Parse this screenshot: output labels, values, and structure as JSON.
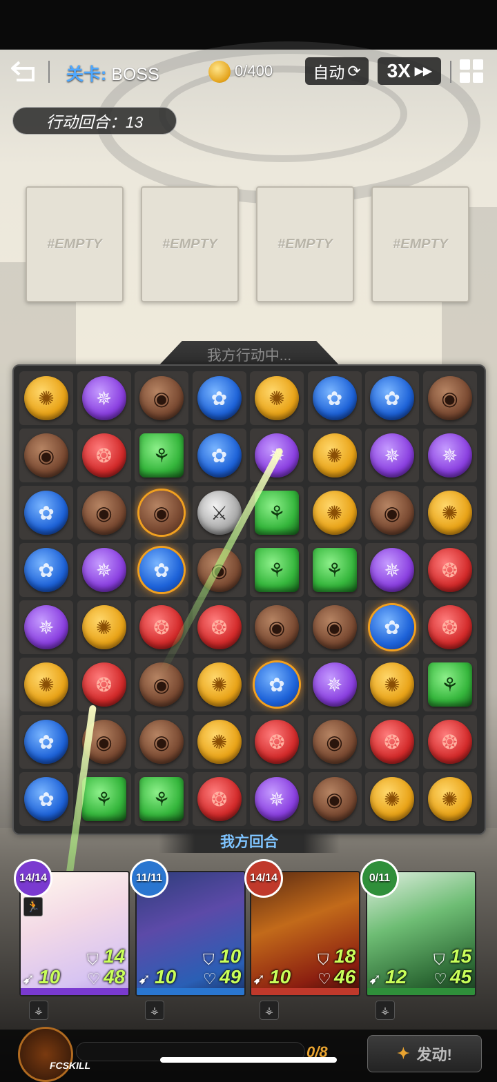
{
  "topbar": {
    "stage_key": "关卡:",
    "stage_value": "BOSS",
    "coins": "0/400",
    "auto_label": "自动",
    "speed_label": "3X"
  },
  "turns_label": "行动回合：13",
  "empty_slots": [
    "#EMPTY",
    "#EMPTY",
    "#EMPTY",
    "#EMPTY"
  ],
  "board": {
    "status": "我方行动中...",
    "turn_banner": "我方回合",
    "rows": [
      [
        "yellow",
        "purple",
        "brown",
        "blue",
        "yellow",
        "blue",
        "blue",
        "brown"
      ],
      [
        "brown",
        "red",
        "green",
        "blue",
        "purple",
        "yellow",
        "purple",
        "purple"
      ],
      [
        "blue",
        "brown",
        "brown",
        "sword",
        "green",
        "yellow",
        "brown",
        "yellow"
      ],
      [
        "blue",
        "purple",
        "blue",
        "brown",
        "green",
        "green",
        "purple",
        "red"
      ],
      [
        "purple",
        "yellow",
        "red",
        "red",
        "brown",
        "brown",
        "blue",
        "red"
      ],
      [
        "yellow",
        "red",
        "brown",
        "yellow",
        "blue",
        "purple",
        "yellow",
        "green"
      ],
      [
        "blue",
        "brown",
        "brown",
        "yellow",
        "red",
        "brown",
        "red",
        "red"
      ],
      [
        "blue",
        "green",
        "green",
        "red",
        "purple",
        "brown",
        "yellow",
        "yellow"
      ]
    ]
  },
  "heroes": [
    {
      "hp": "14/14",
      "def": "14",
      "atk": "10",
      "health": "48",
      "color": "#7a3ad0"
    },
    {
      "hp": "11/11",
      "def": "10",
      "atk": "10",
      "health": "49",
      "color": "#2a76d0"
    },
    {
      "hp": "14/14",
      "def": "18",
      "atk": "10",
      "health": "46",
      "color": "#c0392b"
    },
    {
      "hp": "0/11",
      "def": "15",
      "atk": "12",
      "health": "45",
      "color": "#2f8f3a"
    }
  ],
  "bottom": {
    "fcskill_label": "FCSKILL",
    "energy": "0/8",
    "fire_label": "发动!"
  },
  "colors": {
    "accent_blue": "#4ea8ff",
    "energy_text": "#e8a330",
    "stat_green": "#c9ff5a"
  }
}
